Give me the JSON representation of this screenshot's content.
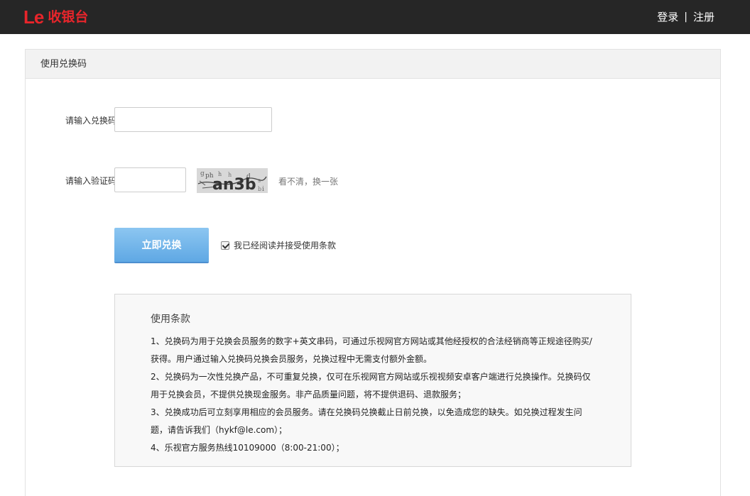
{
  "header": {
    "logo_mark": "Le",
    "logo_text": "收银台",
    "login_label": "登录",
    "separator": "|",
    "register_label": "注册"
  },
  "panel": {
    "title": "使用兑换码"
  },
  "form": {
    "code_label": "请输入兑换码：",
    "code_value": "",
    "verify_label": "请输入验证码：",
    "verify_value": "",
    "captcha_text": "an3b",
    "refresh_link": "看不清，换一张",
    "submit_label": "立即兑换",
    "agree_label": "我已经阅读并接受使用条款",
    "agree_checked": true
  },
  "terms": {
    "title": "使用条款",
    "lines": [
      "1、兑换码为用于兑换会员服务的数字+英文串码，可通过乐视网官方网站或其他经授权的合法经销商等正规途径购买/",
      "获得。用户通过输入兑换码兑换会员服务，兑换过程中无需支付额外金额。",
      "2、兑换码为一次性兑换产品，不可重复兑换，仅可在乐视网官方网站或乐视视频安卓客户端进行兑换操作。兑换码仅",
      "用于兑换会员，不提供兑换现金服务。非产品质量问题，将不提供退码、退款服务；",
      "3、兑换成功后可立刻享用相应的会员服务。请在兑换码兑换截止日前兑换，以免造成您的缺失。如兑换过程发生问",
      "题，请告诉我们（hykf@le.com）；",
      "4、乐视官方服务热线10109000（8:00-21:00）；"
    ]
  },
  "colors": {
    "topbar": "#262626",
    "brand_red": "#e8252b",
    "button_blue": "#6ab0e8"
  }
}
